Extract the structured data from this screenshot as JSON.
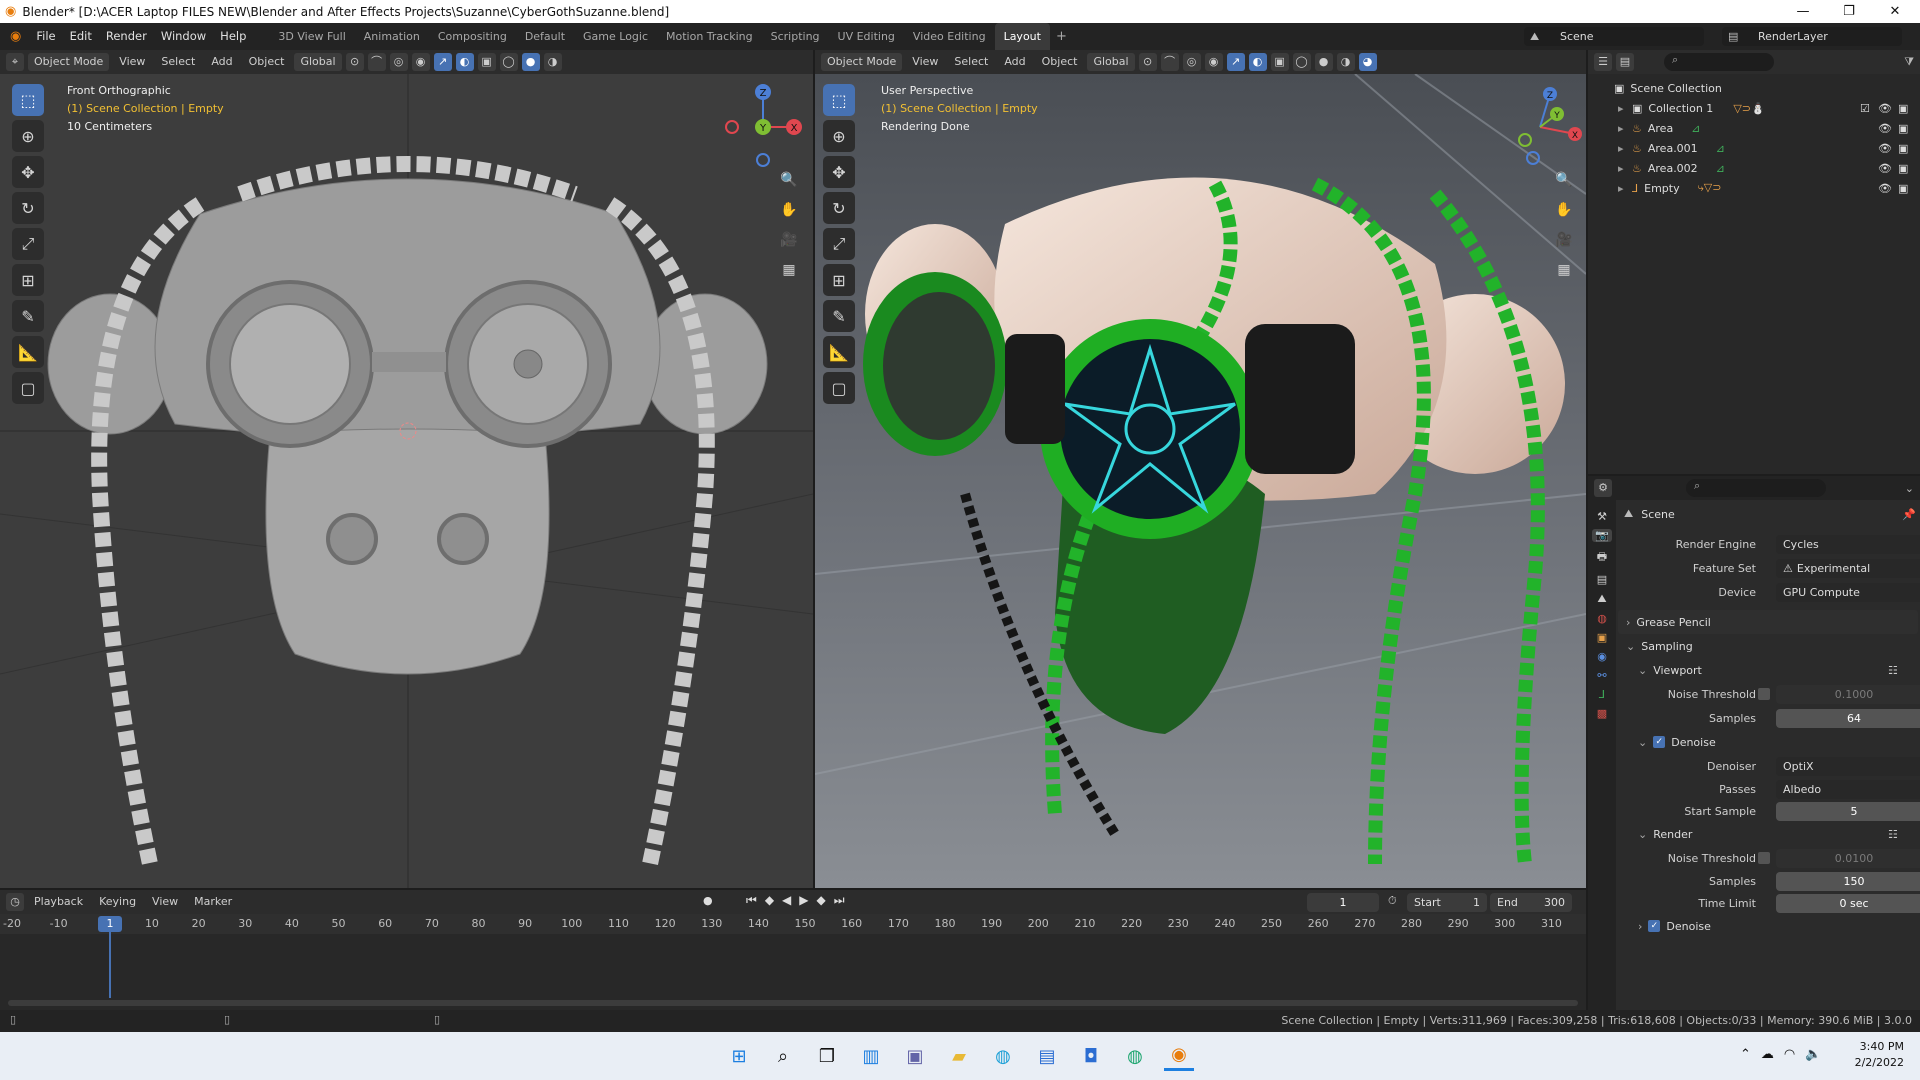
{
  "window": {
    "title": "Blender* [D:\\ACER Laptop FILES NEW\\Blender and After Effects Projects\\Suzanne\\CyberGothSuzanne.blend]",
    "minimize": "—",
    "maximize": "❐",
    "close": "✕"
  },
  "menus": [
    "File",
    "Edit",
    "Render",
    "Window",
    "Help"
  ],
  "workspaces": [
    "3D View Full",
    "Animation",
    "Compositing",
    "Default",
    "Game Logic",
    "Motion Tracking",
    "Scripting",
    "UV Editing",
    "Video Editing",
    "Layout"
  ],
  "scene_name": "Scene",
  "view_layer": "RenderLayer",
  "left_view": {
    "mode": "Object Mode",
    "menus": [
      "View",
      "Select",
      "Add",
      "Object"
    ],
    "orientation": "Global",
    "title": "Front Orthographic",
    "subtitle": "(1) Scene Collection | Empty",
    "scale": "10 Centimeters"
  },
  "right_view": {
    "mode": "Object Mode",
    "menus": [
      "View",
      "Select",
      "Add",
      "Object"
    ],
    "orientation": "Global",
    "title": "User Perspective",
    "subtitle": "(1) Scene Collection | Empty",
    "status": "Rendering Done"
  },
  "gizmo": {
    "x": "X",
    "y": "Y",
    "z": "Z"
  },
  "outliner": {
    "root": "Scene Collection",
    "items": [
      "Collection 1",
      "Area",
      "Area.001",
      "Area.002",
      "Empty"
    ]
  },
  "properties": {
    "context": "Scene",
    "render_engine": {
      "label": "Render Engine",
      "value": "Cycles"
    },
    "feature_set": {
      "label": "Feature Set",
      "value": "Experimental"
    },
    "device": {
      "label": "Device",
      "value": "GPU Compute"
    },
    "grease_pencil": "Grease Pencil",
    "sampling": "Sampling",
    "viewport": "Viewport",
    "vp_noise": {
      "label": "Noise Threshold",
      "value": "0.1000"
    },
    "vp_samples": {
      "label": "Samples",
      "value": "64"
    },
    "denoise": "Denoise",
    "denoiser": {
      "label": "Denoiser",
      "value": "OptiX"
    },
    "passes": {
      "label": "Passes",
      "value": "Albedo"
    },
    "start_sample": {
      "label": "Start Sample",
      "value": "5"
    },
    "render": "Render",
    "r_noise": {
      "label": "Noise Threshold",
      "value": "0.0100"
    },
    "r_samples": {
      "label": "Samples",
      "value": "150"
    },
    "time_limit": {
      "label": "Time Limit",
      "value": "0 sec"
    },
    "denoise2": "Denoise"
  },
  "timeline": {
    "menus": [
      "Playback",
      "Keying",
      "View",
      "Marker"
    ],
    "current_frame": "1",
    "start_label": "Start",
    "start": "1",
    "end_label": "End",
    "end": "300",
    "ticks": [
      "-20",
      "-10",
      "1",
      "10",
      "20",
      "30",
      "40",
      "50",
      "60",
      "70",
      "80",
      "90",
      "100",
      "110",
      "120",
      "130",
      "140",
      "150",
      "160",
      "170",
      "180",
      "190",
      "200",
      "210",
      "220",
      "230",
      "240",
      "250",
      "260",
      "270",
      "280",
      "290",
      "300",
      "310"
    ]
  },
  "statusbar": "Scene Collection | Empty | Verts:311,969 | Faces:309,258 | Tris:618,608 | Objects:0/33 | Memory: 390.6 MiB | 3.0.0",
  "taskbar": {
    "time": "3:40 PM",
    "date": "2/2/2022"
  }
}
